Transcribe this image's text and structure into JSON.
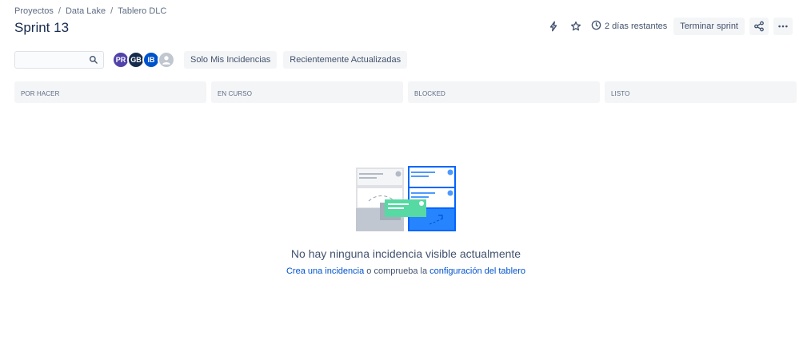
{
  "breadcrumb": {
    "items": [
      "Proyectos",
      "Data Lake",
      "Tablero DLC"
    ],
    "separator": "/"
  },
  "page": {
    "title": "Sprint 13"
  },
  "header": {
    "time_remaining": "2 días restantes",
    "end_sprint_label": "Terminar sprint",
    "icons": [
      "lightning-icon",
      "star-icon",
      "clock-icon",
      "share-icon",
      "more-icon"
    ]
  },
  "toolbar": {
    "search_placeholder": "",
    "avatars": [
      {
        "initials": "PR",
        "color": "#5243aa"
      },
      {
        "initials": "GB",
        "color": "#172b4d"
      },
      {
        "initials": "IB",
        "color": "#0052cc"
      },
      {
        "initials": "",
        "color": "#c1c7d0"
      }
    ],
    "filters": [
      "Solo Mis Incidencias",
      "Recientemente Actualizadas"
    ]
  },
  "columns": [
    "POR HACER",
    "EN CURSO",
    "BLOCKED",
    "LISTO"
  ],
  "empty_state": {
    "title": "No hay ninguna incidencia visible actualmente",
    "create_link": "Crea una incidencia",
    "middle_text": " o comprueba la ",
    "config_link": "configuración del tablero"
  },
  "colors": {
    "accent": "#0052cc",
    "illustration_blue": "#0065ff",
    "illustration_green": "#57d9a3"
  }
}
